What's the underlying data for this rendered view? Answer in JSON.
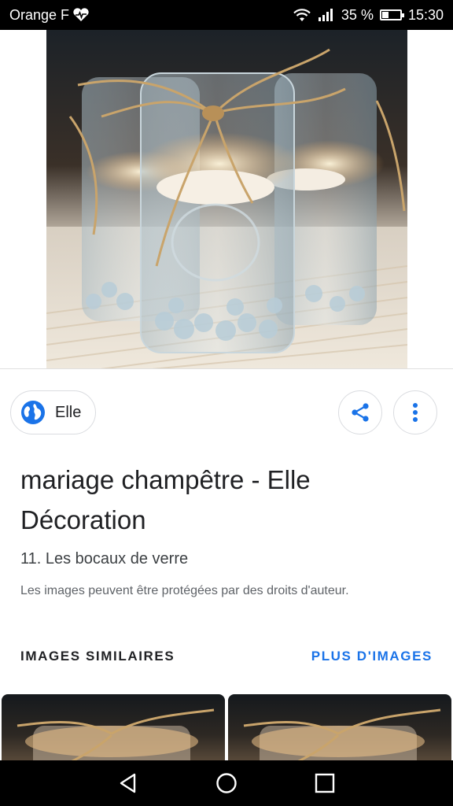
{
  "status_bar": {
    "carrier": "Orange F",
    "battery_percent": "35 %",
    "battery_level": 0.35,
    "time": "15:30",
    "icons": [
      "heart-monitor-icon",
      "wifi-icon",
      "signal-icon",
      "battery-icon"
    ]
  },
  "hero": {
    "image_name": "mason-jar-candles-image"
  },
  "source": {
    "name": "Elle",
    "icon": "globe-icon",
    "accent": "#1a73e8"
  },
  "actions": {
    "share_icon": "share-icon",
    "more_icon": "more-vert-icon"
  },
  "result": {
    "title": "mariage champêtre - Elle Décoration",
    "subtitle": "11. Les bocaux de verre",
    "copyright": "Les images peuvent être protégées par des droits d'auteur."
  },
  "similar": {
    "heading": "IMAGES SIMILAIRES",
    "more_label": "PLUS D'IMAGES",
    "more_color": "#1a73e8"
  },
  "nav_bar": {
    "icons": [
      "back-icon",
      "home-icon",
      "recents-icon"
    ]
  }
}
